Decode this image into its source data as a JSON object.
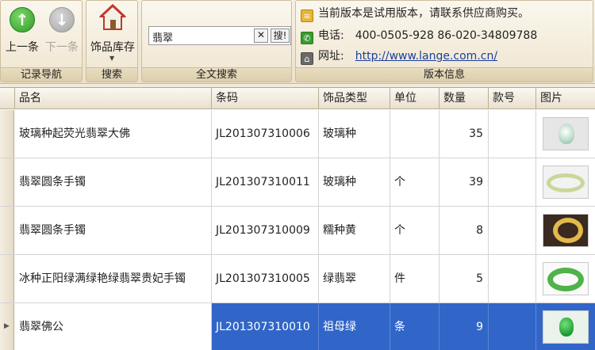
{
  "ribbon": {
    "nav": {
      "prev_label": "上一条",
      "next_label": "下一条",
      "group_label": "记录导航"
    },
    "search": {
      "inventory_label": "饰品库存",
      "group_label": "搜索"
    },
    "fulltext": {
      "value": "翡翠",
      "clear_label": "✕",
      "go_label": "搜!",
      "group_label": "全文搜索"
    },
    "version": {
      "notice": "当前版本是试用版本，请联系供应商购买。",
      "phone_label": "电话:",
      "phone_value": "400-0505-928  86-020-34809788",
      "site_label": "网址:",
      "site_value": "http://www.lange.com.cn/",
      "group_label": "版本信息"
    }
  },
  "table": {
    "columns": [
      "品名",
      "条码",
      "饰品类型",
      "单位",
      "数量",
      "款号",
      "图片"
    ],
    "rows": [
      {
        "name": "玻璃种起荧光翡翠大佛",
        "barcode": "JL201307310006",
        "type": "玻璃种",
        "unit": "",
        "qty": "35",
        "style": "",
        "thumb": "buddha"
      },
      {
        "name": "翡翠圆条手镯",
        "barcode": "JL201307310011",
        "type": "玻璃种",
        "unit": "个",
        "qty": "39",
        "style": "",
        "thumb": "bangle-light"
      },
      {
        "name": "翡翠圆条手镯",
        "barcode": "JL201307310009",
        "type": "糯种黄",
        "unit": "个",
        "qty": "8",
        "style": "",
        "thumb": "bangle-yellow"
      },
      {
        "name": "冰种正阳绿满绿艳绿翡翠贵妃手镯",
        "barcode": "JL201307310005",
        "type": "绿翡翠",
        "unit": "件",
        "qty": "5",
        "style": "",
        "thumb": "bangle-green"
      },
      {
        "name": "翡翠佛公",
        "barcode": "JL201307310010",
        "type": "祖母绿",
        "unit": "条",
        "qty": "9",
        "style": "",
        "thumb": "pendant"
      }
    ],
    "selected_row": 4
  },
  "colors": {
    "selection": "#3166c8",
    "ribbon_bg": "#f2eadb",
    "link": "#1a3f9e",
    "phone_icon": "#3a9a2e",
    "prev_icon": "#2e9a23"
  },
  "icons": {
    "prev": "arrow-up-icon",
    "next": "arrow-down-icon",
    "inventory": "house-icon",
    "notice": "document-icon",
    "phone": "phone-icon",
    "site": "home-icon"
  }
}
